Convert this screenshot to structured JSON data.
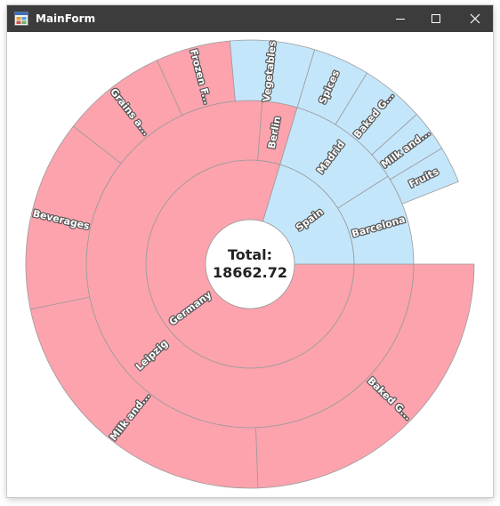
{
  "window": {
    "title": "MainForm"
  },
  "icons": {
    "app": "app-form-icon",
    "minimize": "minimize-icon",
    "maximize": "maximize-icon",
    "close": "close-icon"
  },
  "colors": {
    "germany": "#fca3ae",
    "spain": "#c4e6fb",
    "titlebar": "#3c3c3c"
  },
  "chart_data": {
    "type": "sunburst",
    "center_label": "Total:",
    "total": "18662.72",
    "levels": [
      [
        {
          "label": "Germany",
          "share": 0.7966,
          "color": "#fca3ae"
        },
        {
          "label": "Spain",
          "share": 0.2034,
          "color": "#c4e6fb"
        }
      ],
      [
        {
          "label": "Leipzig",
          "share": 0.7619,
          "color": "#fca3ae"
        },
        {
          "label": "Berlin",
          "share": 0.0347,
          "color": "#fca3ae"
        },
        {
          "label": "Madrid",
          "share": 0.1131,
          "color": "#c4e6fb"
        },
        {
          "label": "Barcelona",
          "share": 0.0903,
          "color": "#c4e6fb"
        }
      ],
      [
        {
          "label": "Baked G...",
          "share": 0.2444,
          "color": "#fca3ae"
        },
        {
          "label": "Milk and...",
          "share": 0.2233,
          "color": "#fca3ae"
        },
        {
          "label": "Beverages",
          "share": 0.1378,
          "color": "#fca3ae"
        },
        {
          "label": "Grains a...",
          "share": 0.0764,
          "color": "#fca3ae"
        },
        {
          "label": "Berlin",
          "share": 0.0,
          "color": "#fca3ae",
          "hidden": true
        },
        {
          "label": "Frozen F...",
          "share": 0.0538,
          "color": "#fca3ae"
        },
        {
          "label": "Vegetables",
          "share": 0.0609,
          "color": "#c4e6fb"
        },
        {
          "label": "Spices",
          "share": 0.0408,
          "color": "#c4e6fb"
        },
        {
          "label": "Baked G...",
          "share": 0.0461,
          "color": "#c4e6fb"
        },
        {
          "label": "Milk and...",
          "share": 0.03,
          "color": "#c4e6fb"
        },
        {
          "label": "Fruits",
          "share": 0.0265,
          "color": "#c4e6fb"
        }
      ]
    ]
  }
}
